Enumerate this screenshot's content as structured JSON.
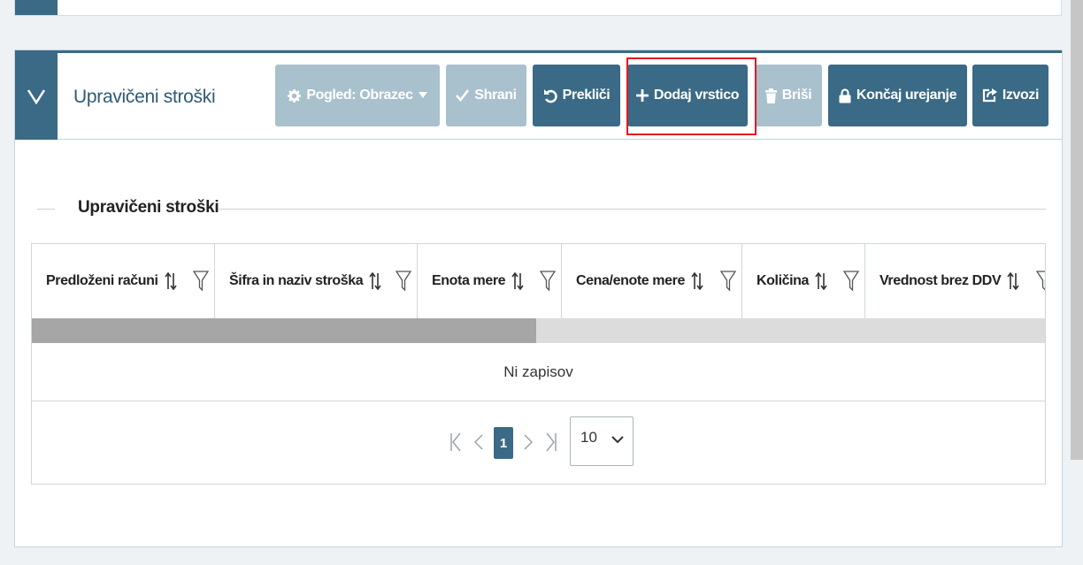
{
  "panel": {
    "title": "Upravičeni stroški"
  },
  "toolbar": {
    "view_label": "Pogled: Obrazec",
    "save_label": "Shrani",
    "cancel_label": "Prekliči",
    "add_row_label": "Dodaj vrstico",
    "delete_label": "Briši",
    "finish_edit_label": "Končaj urejanje",
    "export_label": "Izvozi"
  },
  "section": {
    "legend": "Upravičeni stroški"
  },
  "table": {
    "columns": [
      "Predloženi računi",
      "Šifra in naziv stroška",
      "Enota mere",
      "Cena/enote mere",
      "Količina",
      "Vrednost brez DDV"
    ],
    "empty_text": "Ni zapisov"
  },
  "pager": {
    "current_page": "1",
    "page_size": "10"
  },
  "colors": {
    "accent": "#3a6a85",
    "accent_disabled": "#a9c0cd",
    "highlight": "#e1191f"
  }
}
